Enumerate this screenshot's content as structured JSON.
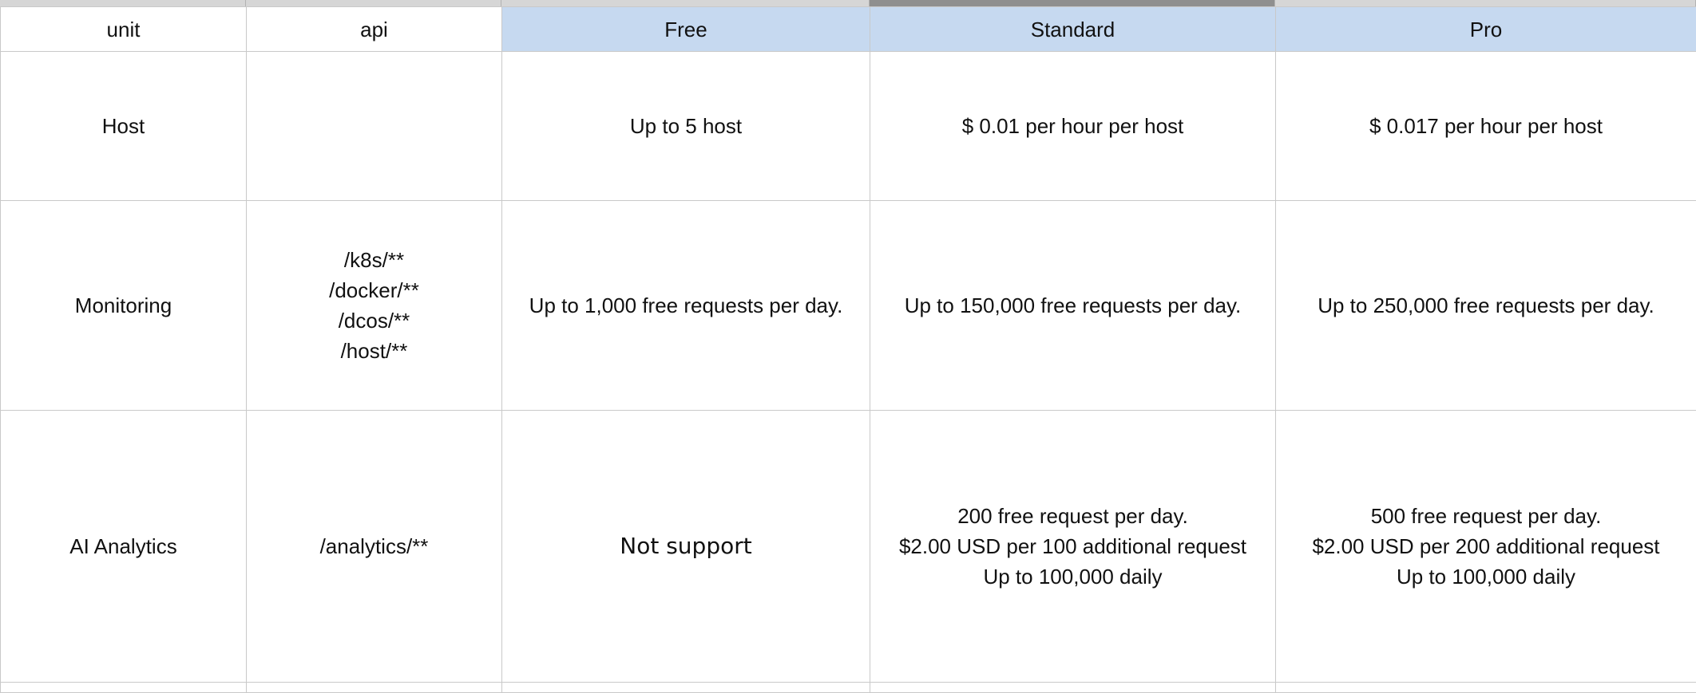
{
  "sheet": {
    "headers": {
      "unit": "unit",
      "api": "api",
      "free": "Free",
      "standard": "Standard",
      "pro": "Pro"
    },
    "rows": {
      "host": {
        "unit": "Host",
        "api": "",
        "free": "Up to 5 host",
        "standard": "$ 0.01 per hour per host",
        "pro": "$ 0.017 per hour per host"
      },
      "monitoring": {
        "unit": "Monitoring",
        "api": [
          "/k8s/**",
          "/docker/**",
          "/dcos/**",
          "/host/**"
        ],
        "free": "Up to 1,000 free requests per day.",
        "standard": "Up to 150,000 free requests per day.",
        "pro": "Up to 250,000 free requests per day."
      },
      "ai_analytics": {
        "unit": "AI Analytics",
        "api": "/analytics/**",
        "free": "Not support",
        "standard": [
          "200 free request per day.",
          "$2.00 USD per 100 additional request",
          "Up to 100,000 daily"
        ],
        "pro": [
          "500 free request per day.",
          "$2.00 USD per 200 additional request",
          "Up to 100,000 daily"
        ]
      }
    },
    "colors": {
      "tier_header_fill": "#c6d9f0",
      "grid_line": "#c9c9c9"
    }
  }
}
